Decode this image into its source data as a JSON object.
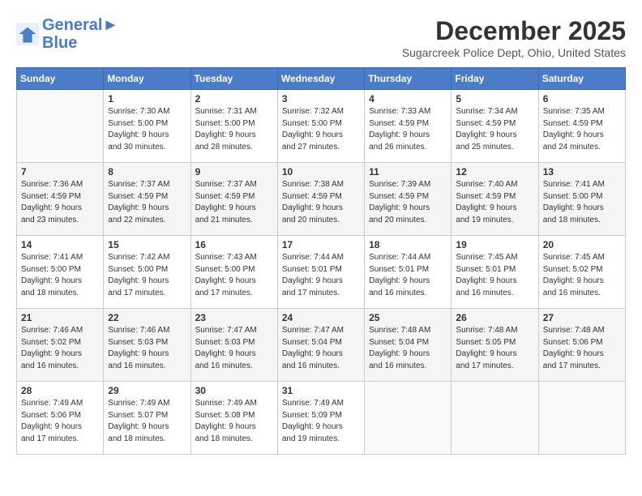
{
  "logo": {
    "line1": "General",
    "line2": "Blue"
  },
  "title": "December 2025",
  "subtitle": "Sugarcreek Police Dept, Ohio, United States",
  "weekdays": [
    "Sunday",
    "Monday",
    "Tuesday",
    "Wednesday",
    "Thursday",
    "Friday",
    "Saturday"
  ],
  "weeks": [
    [
      {
        "day": "",
        "info": ""
      },
      {
        "day": "1",
        "info": "Sunrise: 7:30 AM\nSunset: 5:00 PM\nDaylight: 9 hours\nand 30 minutes."
      },
      {
        "day": "2",
        "info": "Sunrise: 7:31 AM\nSunset: 5:00 PM\nDaylight: 9 hours\nand 28 minutes."
      },
      {
        "day": "3",
        "info": "Sunrise: 7:32 AM\nSunset: 5:00 PM\nDaylight: 9 hours\nand 27 minutes."
      },
      {
        "day": "4",
        "info": "Sunrise: 7:33 AM\nSunset: 4:59 PM\nDaylight: 9 hours\nand 26 minutes."
      },
      {
        "day": "5",
        "info": "Sunrise: 7:34 AM\nSunset: 4:59 PM\nDaylight: 9 hours\nand 25 minutes."
      },
      {
        "day": "6",
        "info": "Sunrise: 7:35 AM\nSunset: 4:59 PM\nDaylight: 9 hours\nand 24 minutes."
      }
    ],
    [
      {
        "day": "7",
        "info": "Sunrise: 7:36 AM\nSunset: 4:59 PM\nDaylight: 9 hours\nand 23 minutes."
      },
      {
        "day": "8",
        "info": "Sunrise: 7:37 AM\nSunset: 4:59 PM\nDaylight: 9 hours\nand 22 minutes."
      },
      {
        "day": "9",
        "info": "Sunrise: 7:37 AM\nSunset: 4:59 PM\nDaylight: 9 hours\nand 21 minutes."
      },
      {
        "day": "10",
        "info": "Sunrise: 7:38 AM\nSunset: 4:59 PM\nDaylight: 9 hours\nand 20 minutes."
      },
      {
        "day": "11",
        "info": "Sunrise: 7:39 AM\nSunset: 4:59 PM\nDaylight: 9 hours\nand 20 minutes."
      },
      {
        "day": "12",
        "info": "Sunrise: 7:40 AM\nSunset: 4:59 PM\nDaylight: 9 hours\nand 19 minutes."
      },
      {
        "day": "13",
        "info": "Sunrise: 7:41 AM\nSunset: 5:00 PM\nDaylight: 9 hours\nand 18 minutes."
      }
    ],
    [
      {
        "day": "14",
        "info": "Sunrise: 7:41 AM\nSunset: 5:00 PM\nDaylight: 9 hours\nand 18 minutes."
      },
      {
        "day": "15",
        "info": "Sunrise: 7:42 AM\nSunset: 5:00 PM\nDaylight: 9 hours\nand 17 minutes."
      },
      {
        "day": "16",
        "info": "Sunrise: 7:43 AM\nSunset: 5:00 PM\nDaylight: 9 hours\nand 17 minutes."
      },
      {
        "day": "17",
        "info": "Sunrise: 7:44 AM\nSunset: 5:01 PM\nDaylight: 9 hours\nand 17 minutes."
      },
      {
        "day": "18",
        "info": "Sunrise: 7:44 AM\nSunset: 5:01 PM\nDaylight: 9 hours\nand 16 minutes."
      },
      {
        "day": "19",
        "info": "Sunrise: 7:45 AM\nSunset: 5:01 PM\nDaylight: 9 hours\nand 16 minutes."
      },
      {
        "day": "20",
        "info": "Sunrise: 7:45 AM\nSunset: 5:02 PM\nDaylight: 9 hours\nand 16 minutes."
      }
    ],
    [
      {
        "day": "21",
        "info": "Sunrise: 7:46 AM\nSunset: 5:02 PM\nDaylight: 9 hours\nand 16 minutes."
      },
      {
        "day": "22",
        "info": "Sunrise: 7:46 AM\nSunset: 5:03 PM\nDaylight: 9 hours\nand 16 minutes."
      },
      {
        "day": "23",
        "info": "Sunrise: 7:47 AM\nSunset: 5:03 PM\nDaylight: 9 hours\nand 16 minutes."
      },
      {
        "day": "24",
        "info": "Sunrise: 7:47 AM\nSunset: 5:04 PM\nDaylight: 9 hours\nand 16 minutes."
      },
      {
        "day": "25",
        "info": "Sunrise: 7:48 AM\nSunset: 5:04 PM\nDaylight: 9 hours\nand 16 minutes."
      },
      {
        "day": "26",
        "info": "Sunrise: 7:48 AM\nSunset: 5:05 PM\nDaylight: 9 hours\nand 17 minutes."
      },
      {
        "day": "27",
        "info": "Sunrise: 7:48 AM\nSunset: 5:06 PM\nDaylight: 9 hours\nand 17 minutes."
      }
    ],
    [
      {
        "day": "28",
        "info": "Sunrise: 7:49 AM\nSunset: 5:06 PM\nDaylight: 9 hours\nand 17 minutes."
      },
      {
        "day": "29",
        "info": "Sunrise: 7:49 AM\nSunset: 5:07 PM\nDaylight: 9 hours\nand 18 minutes."
      },
      {
        "day": "30",
        "info": "Sunrise: 7:49 AM\nSunset: 5:08 PM\nDaylight: 9 hours\nand 18 minutes."
      },
      {
        "day": "31",
        "info": "Sunrise: 7:49 AM\nSunset: 5:09 PM\nDaylight: 9 hours\nand 19 minutes."
      },
      {
        "day": "",
        "info": ""
      },
      {
        "day": "",
        "info": ""
      },
      {
        "day": "",
        "info": ""
      }
    ]
  ]
}
